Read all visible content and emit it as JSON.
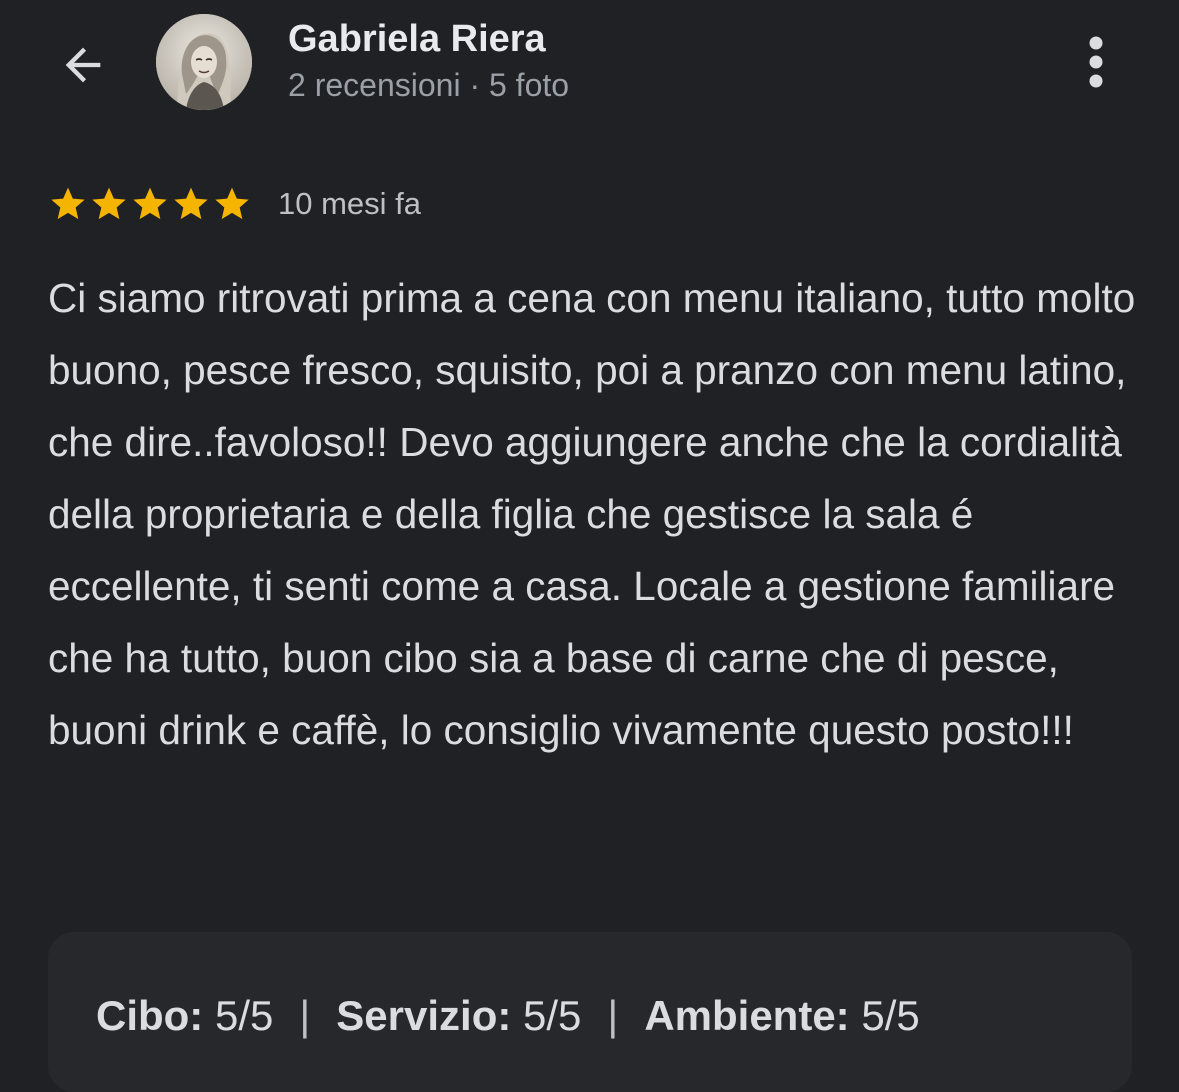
{
  "header": {
    "back_icon": "arrow-left-icon",
    "user_name": "Gabriela Riera",
    "user_meta": "2 recensioni · 5 foto",
    "more_icon": "more-vert-icon"
  },
  "review": {
    "stars": 5,
    "max_stars": 5,
    "star_color": "#F5B400",
    "date": "10 mesi fa",
    "text": "Ci siamo ritrovati prima a cena con menu italiano, tutto molto buono, pesce fresco, squisito, poi a pranzo con menu latino, che dire..favoloso!! Devo aggiungere anche che la cordialità della proprietaria e della figlia che gestisce la sala é eccellente, ti senti come a casa. Locale a gestione familiare che ha tutto, buon cibo sia a base di carne che di pesce, buoni drink e caffè, lo consiglio vivamente questo posto!!!"
  },
  "sub_ratings": [
    {
      "label": "Cibo:",
      "value": "5/5"
    },
    {
      "label": "Servizio:",
      "value": "5/5"
    },
    {
      "label": "Ambiente:",
      "value": "5/5"
    }
  ],
  "separator": "|",
  "colors": {
    "background": "#202124",
    "card": "#27282b",
    "text": "#dadce0",
    "secondary_text": "#9aa0a6"
  }
}
